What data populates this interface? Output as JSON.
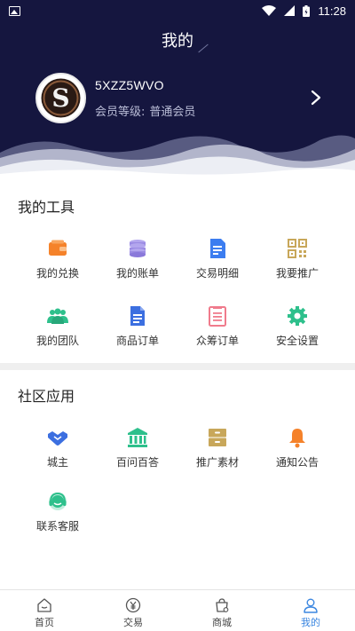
{
  "status_bar": {
    "time": "11:28"
  },
  "header": {
    "title": "我的",
    "user_name": "5XZZ5WVO",
    "member_level_label": "会员等级:",
    "member_level_value": "普通会员"
  },
  "tools": {
    "title": "我的工具",
    "items": [
      {
        "label": "我的兑换",
        "icon": "wallet-icon",
        "color": "#f5822a"
      },
      {
        "label": "我的账单",
        "icon": "coins-icon",
        "color": "#9b8be3"
      },
      {
        "label": "交易明细",
        "icon": "document-icon",
        "color": "#3c7df0"
      },
      {
        "label": "我要推广",
        "icon": "qrcode-icon",
        "color": "#c8a75a"
      },
      {
        "label": "我的团队",
        "icon": "team-icon",
        "color": "#2ec08c"
      },
      {
        "label": "商品订单",
        "icon": "order-doc-icon",
        "color": "#3c6fe0"
      },
      {
        "label": "众筹订单",
        "icon": "list-doc-icon",
        "color": "#f07b8c"
      },
      {
        "label": "安全设置",
        "icon": "gear-icon",
        "color": "#2ec08c"
      }
    ]
  },
  "community": {
    "title": "社区应用",
    "items": [
      {
        "label": "城主",
        "icon": "handshake-icon",
        "color": "#3c6fe0"
      },
      {
        "label": "百问百答",
        "icon": "bank-icon",
        "color": "#2ec08c"
      },
      {
        "label": "推广素材",
        "icon": "cabinet-icon",
        "color": "#c8a75a"
      },
      {
        "label": "通知公告",
        "icon": "bell-icon",
        "color": "#f5822a"
      },
      {
        "label": "联系客服",
        "icon": "headset-icon",
        "color": "#2ec08c"
      }
    ]
  },
  "tabbar": {
    "active_color": "#3a86e0",
    "items": [
      {
        "label": "首页",
        "icon": "home-icon"
      },
      {
        "label": "交易",
        "icon": "yen-icon"
      },
      {
        "label": "商城",
        "icon": "shopping-bag-icon"
      },
      {
        "label": "我的",
        "icon": "user-icon"
      }
    ]
  }
}
